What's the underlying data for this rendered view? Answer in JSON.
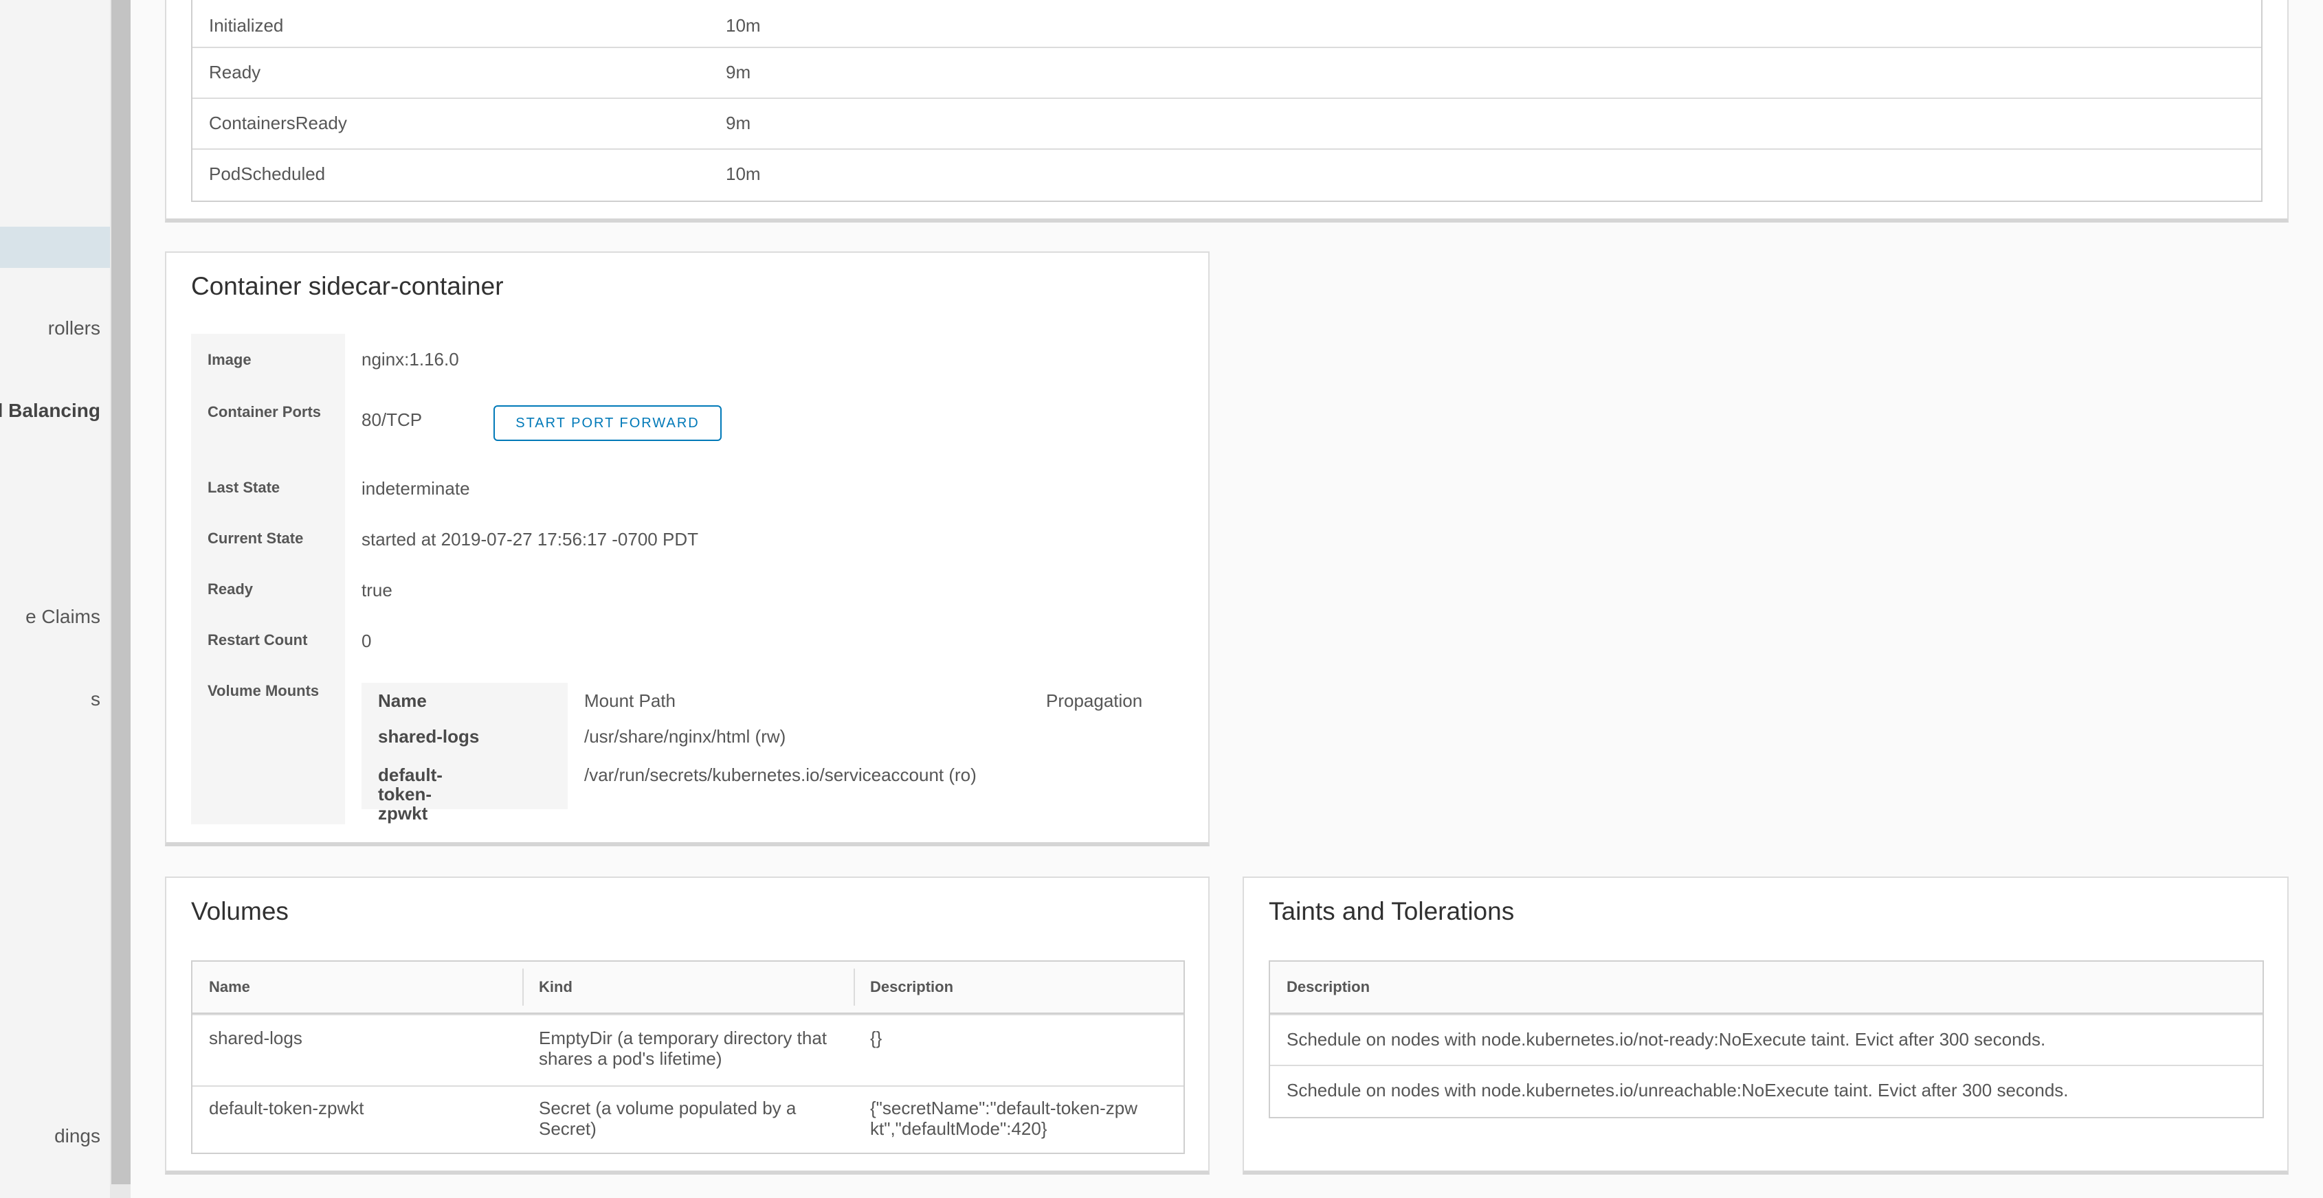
{
  "sidebar": {
    "items": [
      {
        "label": "rollers",
        "bold": false
      },
      {
        "label": "l Balancing",
        "bold": true
      },
      {
        "label": "e Claims",
        "bold": false
      },
      {
        "label": "s",
        "bold": false
      },
      {
        "label": "dings",
        "bold": false
      }
    ]
  },
  "conditions": {
    "rows": [
      {
        "type": "Initialized",
        "age": "10m"
      },
      {
        "type": "Ready",
        "age": "9m"
      },
      {
        "type": "ContainersReady",
        "age": "9m"
      },
      {
        "type": "PodScheduled",
        "age": "10m"
      }
    ]
  },
  "container": {
    "title": "Container sidecar-container",
    "image_label": "Image",
    "image": "nginx:1.16.0",
    "ports_label": "Container Ports",
    "ports": "80/TCP",
    "port_forward_button": "START PORT FORWARD",
    "last_state_label": "Last State",
    "last_state": "indeterminate",
    "current_state_label": "Current State",
    "current_state": "started at 2019-07-27 17:56:17 -0700 PDT",
    "ready_label": "Ready",
    "ready": "true",
    "restart_label": "Restart Count",
    "restart_count": "0",
    "mounts_label": "Volume Mounts",
    "mounts_header": {
      "name": "Name",
      "path": "Mount Path",
      "propagation": "Propagation"
    },
    "mounts": [
      {
        "name": "shared-logs",
        "path": "/usr/share/nginx/html (rw)",
        "propagation": ""
      },
      {
        "name": "default-token-zpwkt",
        "path": "/var/run/secrets/kubernetes.io/serviceaccount (ro)",
        "propagation": ""
      }
    ]
  },
  "volumes": {
    "title": "Volumes",
    "headers": {
      "name": "Name",
      "kind": "Kind",
      "description": "Description"
    },
    "rows": [
      {
        "name": "shared-logs",
        "kind": "EmptyDir (a temporary directory that shares a pod's lifetime)",
        "description": "{}"
      },
      {
        "name": "default-token-zpwkt",
        "kind": "Secret (a volume populated by a Secret)",
        "description": "{\"secretName\":\"default-token-zpwkt\",\"defaultMode\":420}"
      }
    ]
  },
  "taints": {
    "title": "Taints and Tolerations",
    "header": "Description",
    "rows": [
      "Schedule on nodes with node.kubernetes.io/not-ready:NoExecute taint. Evict after 300 seconds.",
      "Schedule on nodes with node.kubernetes.io/unreachable:NoExecute taint. Evict after 300 seconds."
    ]
  }
}
